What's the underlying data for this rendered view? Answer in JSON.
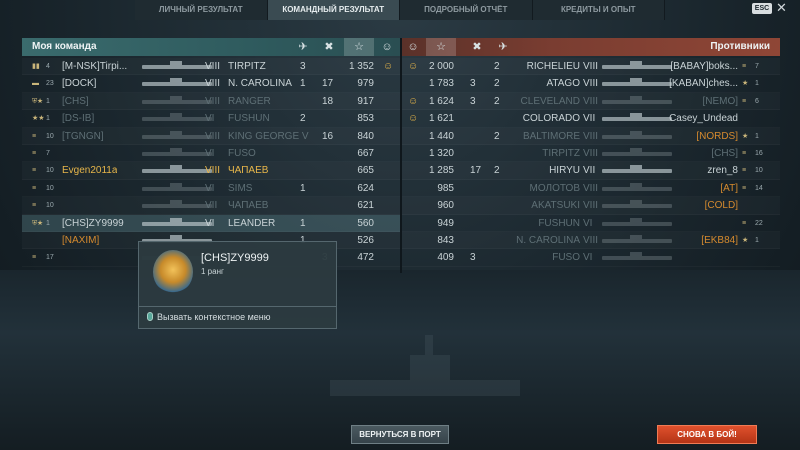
{
  "tabs": [
    {
      "label": "ЛИЧНЫЙ РЕЗУЛЬТАТ",
      "active": false
    },
    {
      "label": "КОМАНДНЫЙ РЕЗУЛЬТАТ",
      "active": true
    },
    {
      "label": "ПОДРОБНЫЙ ОТЧЁТ",
      "active": false
    },
    {
      "label": "КРЕДИТЫ И ОПЫТ",
      "active": false
    }
  ],
  "esc_label": "ESC",
  "close_glyph": "✕",
  "my_team": {
    "title": "Моя команда",
    "header_icons": [
      "✈",
      "✖",
      "☆",
      "☺"
    ],
    "rows": [
      {
        "badge": "▮▮",
        "rank": "4",
        "name": "[M-NSK]Tirpi...",
        "tier": "VIII",
        "ship": "TIRPITZ",
        "planes": "3",
        "kills": "",
        "xp": "1 352",
        "medal": "☺",
        "muted": false
      },
      {
        "badge": "▬",
        "rank": "23",
        "name": "[DOCK]",
        "tier": "VIII",
        "ship": "N. CAROLINA",
        "planes": "1",
        "kills": "17",
        "xp": "979",
        "medal": "",
        "muted": false
      },
      {
        "badge": "⛨★",
        "rank": "1",
        "name": "[CHS]",
        "tier": "VIII",
        "ship": "RANGER",
        "planes": "",
        "kills": "18",
        "xp": "917",
        "medal": "",
        "muted": true
      },
      {
        "badge": "★★",
        "rank": "1",
        "name": "[DS-IB]",
        "tier": "VI",
        "ship": "FUSHUN",
        "planes": "2",
        "kills": "",
        "xp": "853",
        "medal": "",
        "muted": true
      },
      {
        "badge": "≡",
        "rank": "10",
        "name": "[TGNGN]",
        "tier": "VIII",
        "ship": "KING GEORGE V",
        "planes": "",
        "kills": "16",
        "xp": "840",
        "medal": "",
        "muted": true
      },
      {
        "badge": "≡",
        "rank": "7",
        "name": "",
        "tier": "VI",
        "ship": "FUSO",
        "planes": "",
        "kills": "",
        "xp": "667",
        "medal": "",
        "muted": true
      },
      {
        "badge": "≡",
        "rank": "10",
        "name": "Evgen2011a",
        "tier": "VIII",
        "ship": "ЧАПАЕВ",
        "planes": "",
        "kills": "",
        "xp": "665",
        "medal": "",
        "muted": false,
        "self": true
      },
      {
        "badge": "≡",
        "rank": "10",
        "name": "",
        "tier": "VI",
        "ship": "SIMS",
        "planes": "1",
        "kills": "",
        "xp": "624",
        "medal": "",
        "muted": true
      },
      {
        "badge": "≡",
        "rank": "10",
        "name": "",
        "tier": "VII",
        "ship": "ЧАПАЕВ",
        "planes": "",
        "kills": "",
        "xp": "621",
        "medal": "",
        "muted": true
      },
      {
        "badge": "⛨★",
        "rank": "1",
        "name": "[CHS]ZY9999",
        "tier": "VI",
        "ship": "LEANDER",
        "planes": "1",
        "kills": "",
        "xp": "560",
        "medal": "",
        "muted": false,
        "highlight": true
      },
      {
        "badge": "",
        "rank": "",
        "name": "[NAXIM]",
        "tier": "",
        "ship": "",
        "planes": "1",
        "kills": "",
        "xp": "526",
        "medal": "",
        "muted": false,
        "clan_orange": true
      },
      {
        "badge": "≡",
        "rank": "17",
        "name": "",
        "tier": "",
        "ship": "",
        "planes": "",
        "kills": "3",
        "xp": "472",
        "medal": "",
        "muted": true
      }
    ]
  },
  "enemy_team": {
    "title": "Противники",
    "header_icons": [
      "☺",
      "☆",
      "✖",
      "✈"
    ],
    "rows": [
      {
        "medal": "☺",
        "xp": "2 000",
        "kills": "",
        "planes": "2",
        "ship": "RICHELIEU",
        "tier": "VIII",
        "name": "[BABAY]boks...",
        "rank": "7",
        "badge": "≡",
        "muted": false
      },
      {
        "medal": "",
        "xp": "1 783",
        "kills": "3",
        "planes": "2",
        "ship": "ATAGO",
        "tier": "VIII",
        "name": "[KABAN]ches...",
        "rank": "1",
        "badge": "★",
        "muted": false
      },
      {
        "medal": "☺",
        "xp": "1 624",
        "kills": "3",
        "planes": "2",
        "ship": "CLEVELAND",
        "tier": "VIII",
        "name": "[NEMO]",
        "rank": "6",
        "badge": "≡",
        "muted": true
      },
      {
        "medal": "☺",
        "xp": "1 621",
        "kills": "",
        "planes": "",
        "ship": "COLORADO",
        "tier": "VII",
        "name": "Casey_Undead",
        "rank": "",
        "badge": "",
        "muted": false
      },
      {
        "medal": "",
        "xp": "1 440",
        "kills": "",
        "planes": "2",
        "ship": "BALTIMORE",
        "tier": "VIII",
        "name": "[NORDS]",
        "rank": "1",
        "badge": "★",
        "muted": true,
        "clan_orange": true
      },
      {
        "medal": "",
        "xp": "1 320",
        "kills": "",
        "planes": "",
        "ship": "TIRPITZ",
        "tier": "VIII",
        "name": "[CHS]",
        "rank": "16",
        "badge": "≡",
        "muted": true
      },
      {
        "medal": "",
        "xp": "1 285",
        "kills": "17",
        "planes": "2",
        "ship": "HIRYU",
        "tier": "VII",
        "name": "zren_8",
        "rank": "10",
        "badge": "≡",
        "muted": false
      },
      {
        "medal": "",
        "xp": "985",
        "kills": "",
        "planes": "",
        "ship": "МОЛОТОВ",
        "tier": "VIII",
        "name": "[AT]",
        "rank": "14",
        "badge": "≡",
        "muted": true,
        "clan_orange": true
      },
      {
        "medal": "",
        "xp": "960",
        "kills": "",
        "planes": "",
        "ship": "AKATSUKI",
        "tier": "VIII",
        "name": "[COLD]",
        "rank": "",
        "badge": "",
        "muted": true,
        "clan_orange": true
      },
      {
        "medal": "",
        "xp": "949",
        "kills": "",
        "planes": "",
        "ship": "FUSHUN",
        "tier": "VI",
        "name": "",
        "rank": "22",
        "badge": "≡",
        "muted": true
      },
      {
        "medal": "",
        "xp": "843",
        "kills": "",
        "planes": "",
        "ship": "N. CAROLINA",
        "tier": "VIII",
        "name": "[EKB84]",
        "rank": "1",
        "badge": "★",
        "muted": true,
        "clan_orange": true
      },
      {
        "medal": "",
        "xp": "409",
        "kills": "3",
        "planes": "",
        "ship": "FUSO",
        "tier": "VI",
        "name": "",
        "rank": "",
        "badge": "",
        "muted": true
      }
    ]
  },
  "tooltip": {
    "player": "[CHS]ZY9999",
    "rank": "1 ранг",
    "action": "Вызвать контекстное меню"
  },
  "buttons": {
    "port": "ВЕРНУТЬСЯ В ПОРТ",
    "battle": "СНОВА В БОЙ!"
  }
}
